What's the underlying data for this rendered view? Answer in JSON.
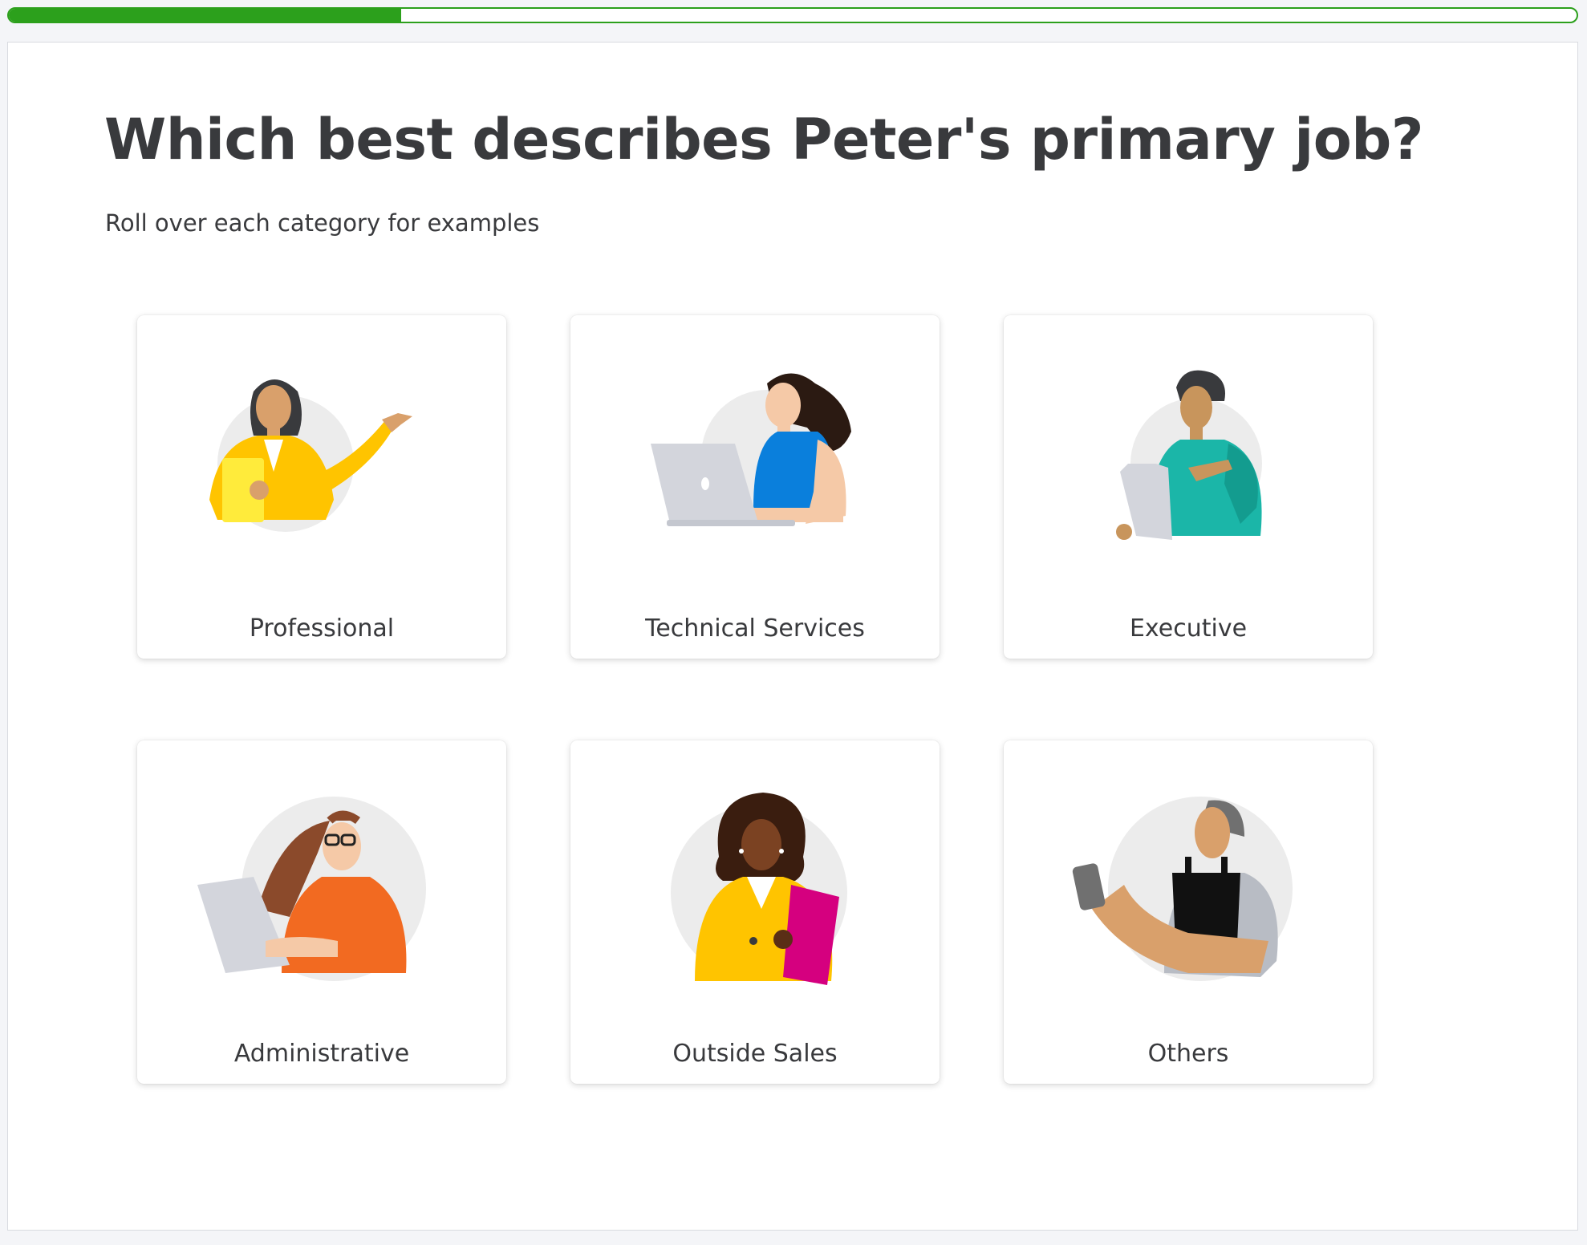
{
  "progress": {
    "fraction": 0.25,
    "color": "#2ca01c"
  },
  "question": {
    "title": "Which best describes Peter's primary job?",
    "subtitle": "Roll over each category for examples"
  },
  "options": [
    {
      "label": "Professional",
      "icon": "professional-woman-illustration",
      "accent": "#ffc107"
    },
    {
      "label": "Technical Services",
      "icon": "technical-services-laptop-illustration",
      "accent": "#0077c5"
    },
    {
      "label": "Executive",
      "icon": "executive-tablet-illustration",
      "accent": "#1bb6a8"
    },
    {
      "label": "Administrative",
      "icon": "administrative-laptop-illustration",
      "accent": "#f26a21"
    },
    {
      "label": "Outside Sales",
      "icon": "outside-sales-folder-illustration",
      "accent": "#ffc107"
    },
    {
      "label": "Others",
      "icon": "others-apron-phone-illustration",
      "accent": "#111111"
    }
  ]
}
